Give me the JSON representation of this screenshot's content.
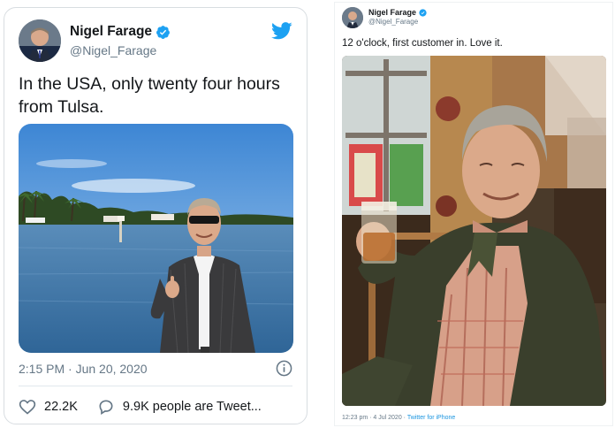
{
  "left_tweet": {
    "author_name": "Nigel Farage",
    "author_handle": "@Nigel_Farage",
    "text": "In the USA, only twenty four hours from Tulsa.",
    "timestamp": "2:15 PM · Jun 20, 2020",
    "likes": "22.2K",
    "replies_text": "9.9K people are Tweet..."
  },
  "right_tweet": {
    "author_name": "Nigel Farage",
    "author_handle": "@Nigel_Farage",
    "text": "12 o'clock, first customer in. Love it.",
    "timestamp": "12:23 pm · 4 Jul 2020 · ",
    "source": "Twitter for iPhone"
  },
  "colors": {
    "twitter_blue": "#1da1f2",
    "text_primary": "#14171a",
    "text_secondary": "#657786",
    "border": "#d8dde1"
  },
  "icons": [
    "verified-badge-icon",
    "twitter-bird-icon",
    "info-icon",
    "heart-icon",
    "speech-bubble-icon"
  ]
}
